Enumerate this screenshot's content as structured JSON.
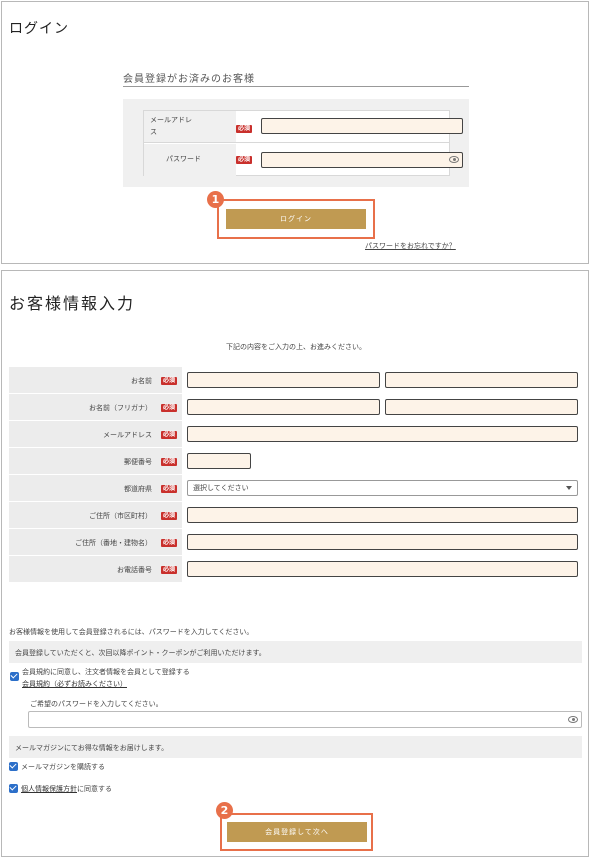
{
  "login": {
    "title": "ログイン",
    "member_heading": "会員登録がお済みのお客様",
    "email_label": "メールアドレス",
    "email_label_line2": "ス",
    "email_label_line1": "メールアドレ",
    "password_label": "パスワード",
    "required": "必須",
    "login_button": "ログイン",
    "forgot_link": "パスワードをお忘れですか？",
    "badge": "1"
  },
  "registration": {
    "title": "お客様情報入力",
    "intro": "下記の内容をご入力の上、お進みください。",
    "required": "必須",
    "fields": [
      {
        "label": "お名前"
      },
      {
        "label": "お名前（フリガナ）"
      },
      {
        "label": "メールアドレス"
      },
      {
        "label": "郵便番号"
      },
      {
        "label": "都道府県"
      },
      {
        "label": "ご住所（市区町村）"
      },
      {
        "label": "ご住所（番地・建物名）"
      },
      {
        "label": "お電話番号"
      }
    ],
    "prefecture_placeholder": "選択してください",
    "pw_note": "お客様情報を使用して会員登録されるには、パスワードを入力してください。",
    "points_note": "会員登録していただくと、次回以降ポイント・クーポンがご利用いただけます。",
    "agree_terms_line1": "会員規約に同意し、注文者情報を会員として登録する",
    "terms_link": "会員規約（必ずお読みください）",
    "pw_prompt": "ご希望のパスワードを入力してください。",
    "mail_note": "メールマガジンにてお得な情報をお届けします。",
    "subscribe": "メールマガジンを購読する",
    "privacy_link": "個人情報保護方針",
    "privacy_suffix": "に同意する",
    "submit_button": "会員登録して次へ",
    "badge": "2"
  },
  "colors": {
    "gold": "#c09a52",
    "highlight": "#e8704a",
    "required_badge": "#c9302c",
    "input_bg": "#fdf3e8",
    "checkbox": "#2c6fc9"
  }
}
